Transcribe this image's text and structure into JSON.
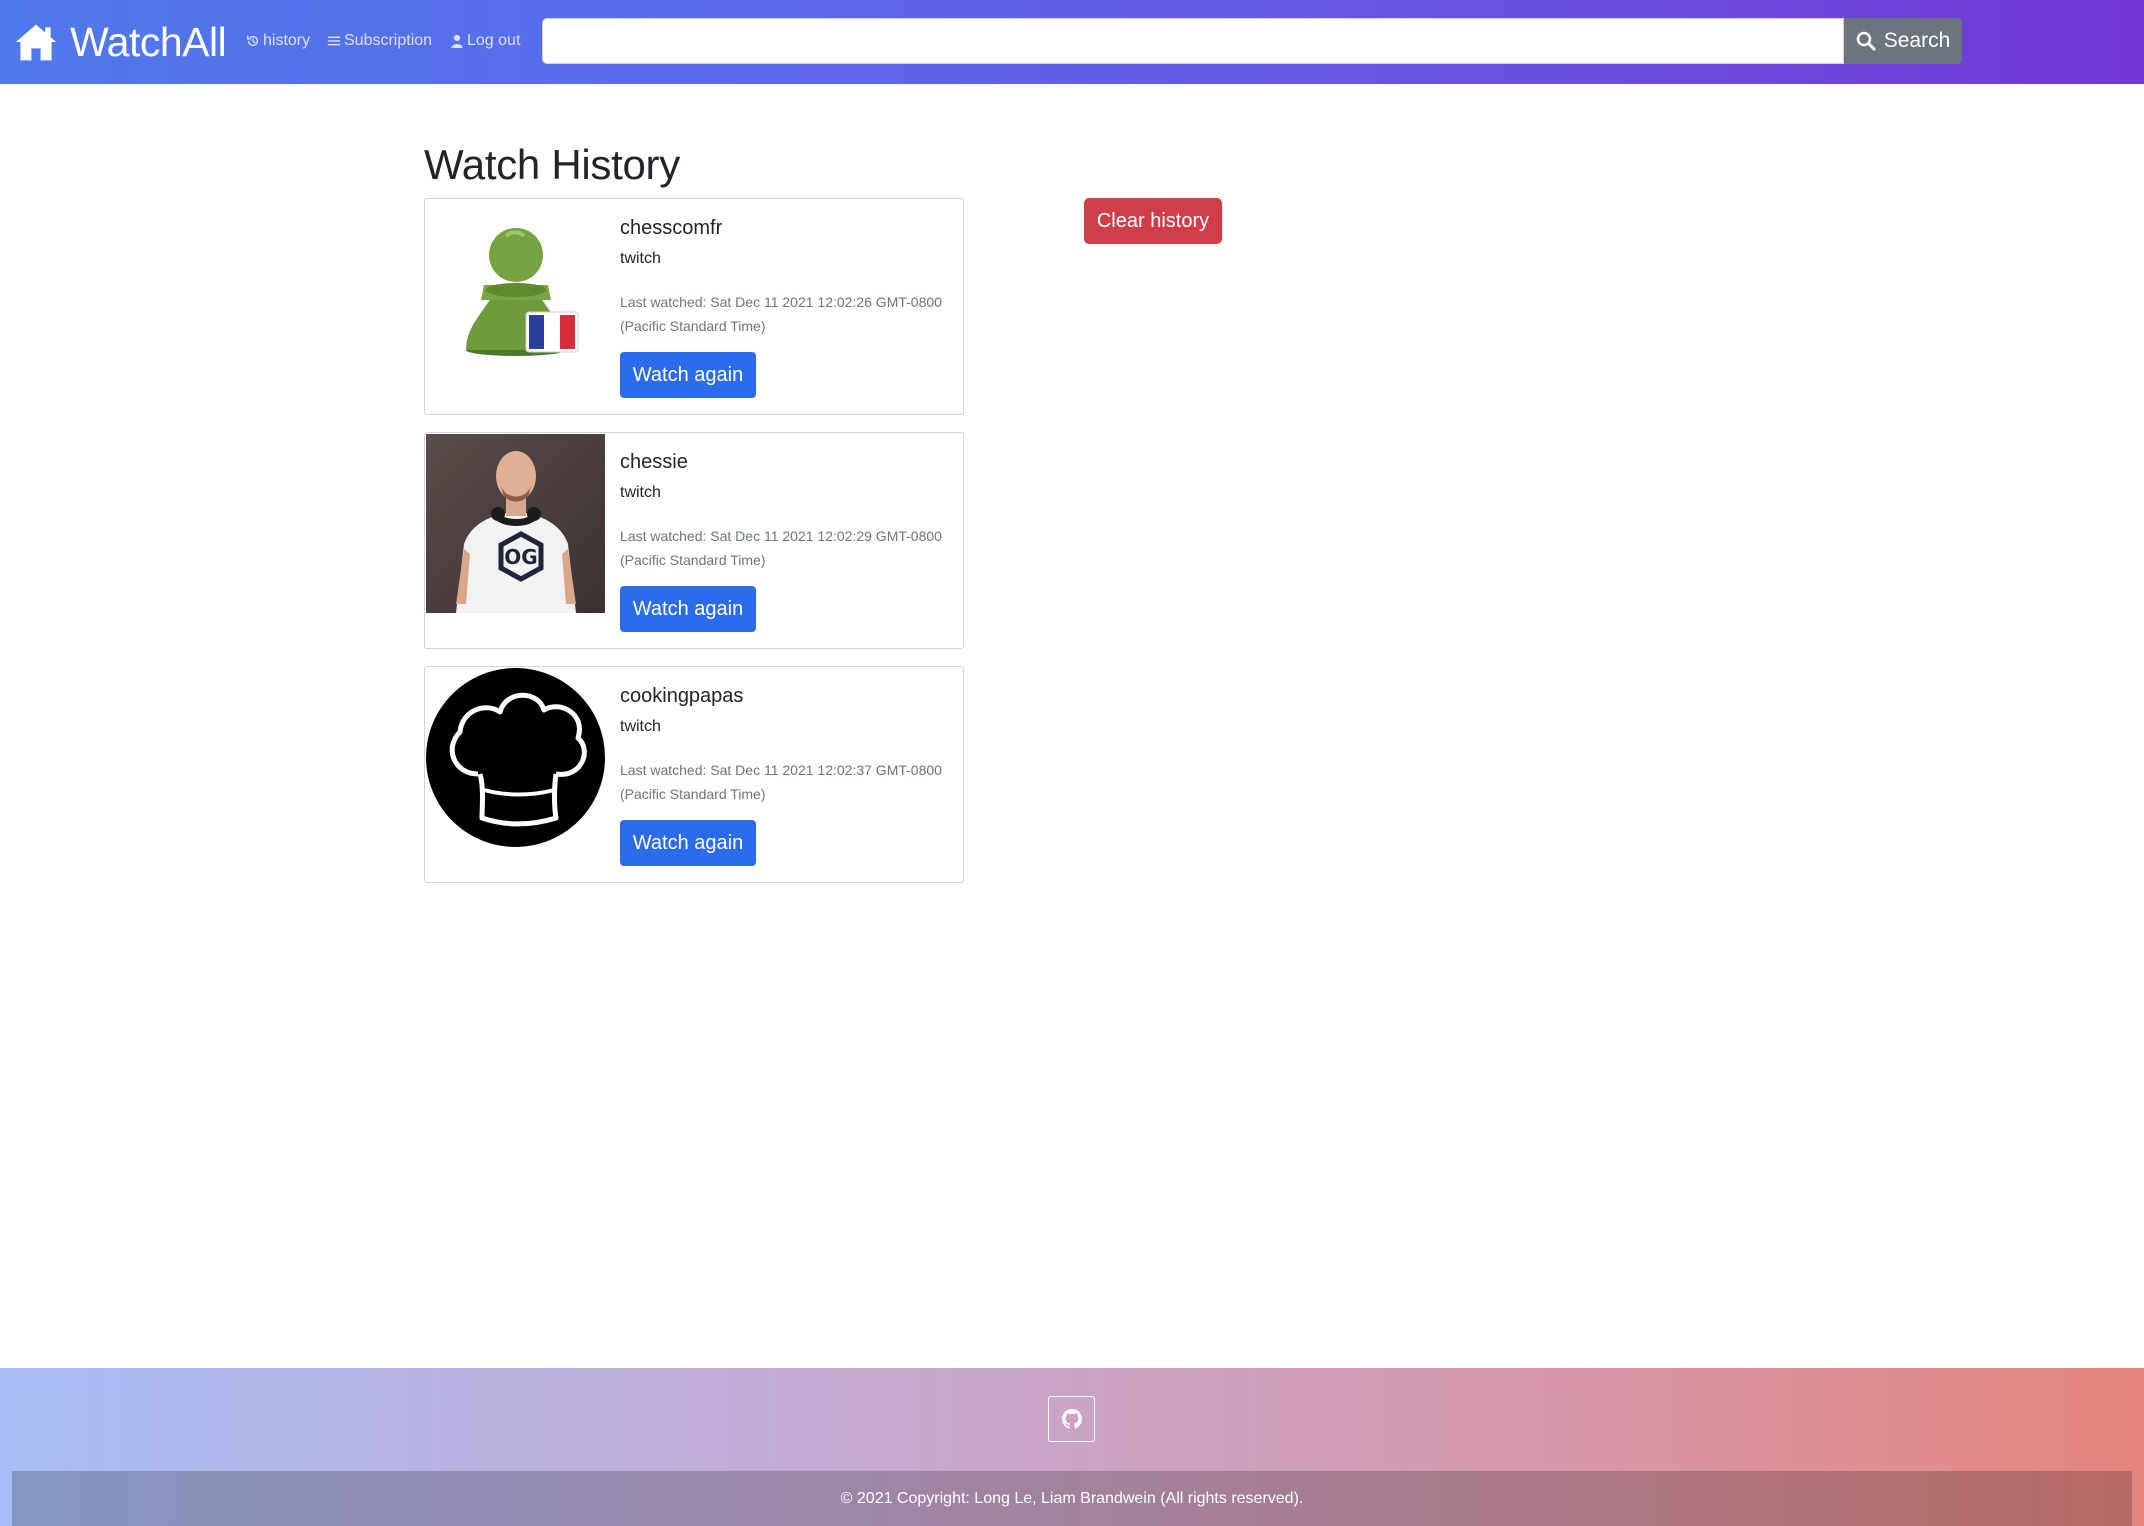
{
  "navbar": {
    "brand": "WatchAll",
    "links": {
      "history": "history",
      "subscription": "Subscription",
      "logout": "Log out"
    },
    "search": {
      "value": "",
      "placeholder": "",
      "button_label": "Search"
    }
  },
  "main": {
    "title": "Watch History",
    "clear_button": "Clear history",
    "history": [
      {
        "name": "chesscomfr",
        "platform": "twitch",
        "last_watched": "Last watched: Sat Dec 11 2021 12:02:26 GMT-0800 (Pacific Standard Time)",
        "button": "Watch again",
        "thumbnail": "green-pawn-french-flag"
      },
      {
        "name": "chessie",
        "platform": "twitch",
        "last_watched": "Last watched: Sat Dec 11 2021 12:02:29 GMT-0800 (Pacific Standard Time)",
        "button": "Watch again",
        "thumbnail": "man-with-headphones-photo"
      },
      {
        "name": "cookingpapas",
        "platform": "twitch",
        "last_watched": "Last watched: Sat Dec 11 2021 12:02:37 GMT-0800 (Pacific Standard Time)",
        "button": "Watch again",
        "thumbnail": "chef-hat-logo"
      }
    ]
  },
  "footer": {
    "github_icon": "github-icon",
    "copyright": "© 2021 Copyright: Long Le, Liam Brandwein (All rights reserved)."
  },
  "colors": {
    "navbar_gradient_start": "#4f79ec",
    "navbar_gradient_end": "#7137d3",
    "primary_button": "#2c6bec",
    "danger_button": "#d03e4a",
    "search_button": "#6c757d",
    "footer_gradient_start": "#a7bcf5",
    "footer_gradient_end": "#e5857e"
  }
}
